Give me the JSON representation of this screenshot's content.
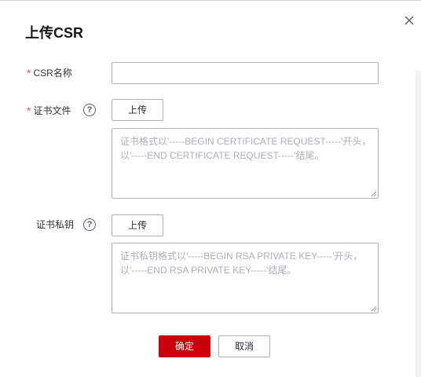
{
  "dialog": {
    "title": "上传CSR",
    "close_icon": "close-icon"
  },
  "form": {
    "csr_name": {
      "required_mark": "*",
      "label": "CSR名称",
      "value": ""
    },
    "cert_file": {
      "required_mark": "*",
      "label": "证书文件",
      "help_icon": "question-circle-icon",
      "help_glyph": "?",
      "upload_label": "上传",
      "placeholder": "证书格式以'-----BEGIN CERTIFICATE REQUEST-----'开头，以'-----END CERTIFICATE REQUEST-----'结尾。"
    },
    "private_key": {
      "label": "证书私钥",
      "help_icon": "question-circle-icon",
      "help_glyph": "?",
      "upload_label": "上传",
      "placeholder": "证书私钥格式以'-----BEGIN RSA PRIVATE KEY-----'开头，以'-----END RSA PRIVATE KEY-----'结尾。"
    }
  },
  "footer": {
    "confirm_label": "确定",
    "cancel_label": "取消"
  },
  "colors": {
    "primary": "#c7000b",
    "required": "#e8524f",
    "border": "#adb0b8",
    "placeholder": "#adb0b8"
  }
}
